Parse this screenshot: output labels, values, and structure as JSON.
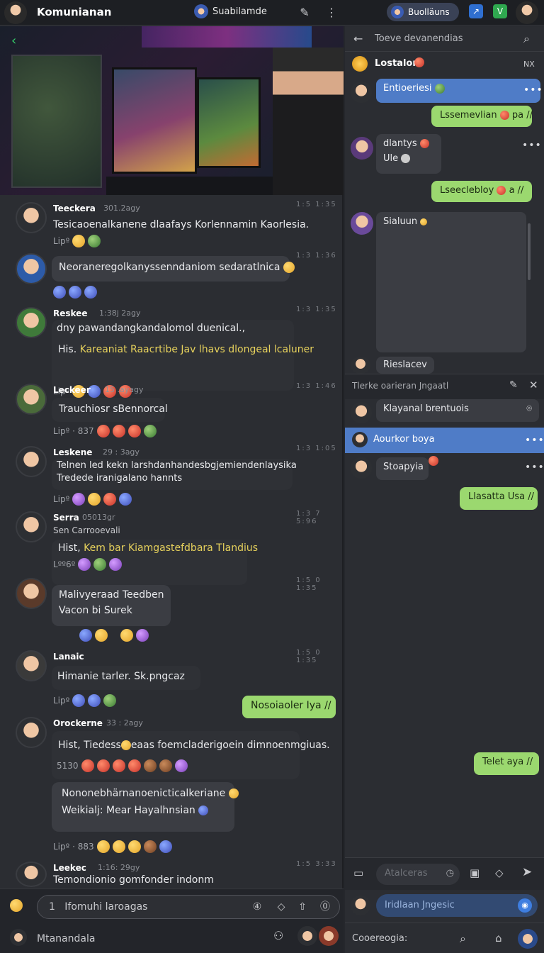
{
  "topbar": {
    "title": "Komunianan",
    "server": "Suabilamde",
    "pill": "Buolläuns",
    "badge1": "↗",
    "badge2": "V"
  },
  "messages": [
    {
      "name": "Teeckera",
      "meta": "301.2agy",
      "right": "1:5  1:35",
      "text": "Tesicaoenalkanene dlaafays Korlennamin Kaorlesia.",
      "reacts": "Lipº"
    },
    {
      "text": "Neoraneregolkanyssenndaniom sedaratlnica",
      "right": "1:3  1:36"
    },
    {
      "name": "Reskee",
      "meta": "1:38j 2agy",
      "right": "1:3  1:35",
      "text": "dny pawandangkandalomol duenical.,",
      "text2": "His.",
      "text2y": "Kareaniat Raacrtibe Jav lhavs dlongeal lcaluner",
      "reacts": "Lipº"
    },
    {
      "name": "Leckeer",
      "meta": "15 .ayagy",
      "right": "1:3  1:46",
      "text": "Trauchiosr sBennorcal",
      "reacts": "Lipº · 837"
    },
    {
      "name": "Leskene",
      "meta": "29 : 3agy",
      "right": "1:3  1:05",
      "text": "Telnen led kekn larshdanhandesbgjemiendenlaysika",
      "text2": "Tredede iranigalano hannts",
      "reacts": "Lipº"
    },
    {
      "name": "Serra",
      "meta": "05013gr",
      "sub": "Sen Carrooevali",
      "right": "1:3 7  5:96",
      "text": "Hist,",
      "texty": "Kem bar Kiamgastefdbara Tlandius",
      "reacts": "Lºº6º"
    },
    {
      "text": "Malivyeraad Teedben",
      "text2": "Vacon bi Surek",
      "right": "1:5 0  1:35"
    },
    {
      "name": "Lanaic",
      "right": "1:5 0  1:35",
      "text": "Himanie tarler. Sk.pngcaz",
      "reacts": "Lipº"
    },
    {
      "green": "Nosoiaoler Iya //"
    },
    {
      "name": "Orockerne",
      "meta": "33 : 2agy",
      "text": "Hist, Tiedess",
      "textb": "eaas foemcladerigoein dimnoenmgiuas.",
      "reacts": "5130"
    },
    {
      "text": "Nononebhärnanoenicticalkeriane",
      "text2": "Weikialj: Mear Hayalhnsian",
      "reacts": "Lipº · 883"
    },
    {
      "name": "Leekec",
      "meta": "1:16: 29gy",
      "right": "1:5  3:33",
      "text": "Temondionio gomfonder indonm"
    }
  ],
  "composer": {
    "placeholder": "Ifomuhi laroagas",
    "num": "1",
    "user": "Mtanandala"
  },
  "rp": {
    "search": "Toeve devanendias",
    "channel": "Lostalon",
    "nx": "NX",
    "b1": "Entioeriesi",
    "g1": "Lssemevlian",
    "g1b": "pa //",
    "m1a": "dlantys",
    "m1b": "Ule",
    "g2": "Lseeclebloy",
    "g2b": "a //",
    "m2": "Sialuun",
    "m3": "Rieslacev",
    "sec": "Tlerke oarieran Jngaatl",
    "in1": "Klayanal brentuois",
    "b2": "Aourkor boya",
    "m4": "Stoapyia",
    "g3": "Llasatta Usa //",
    "g4": "Telet aya //",
    "comp": "Atalceras",
    "comp2": "Iridlaan Jngesic",
    "bottom": "Cooereogia:"
  }
}
